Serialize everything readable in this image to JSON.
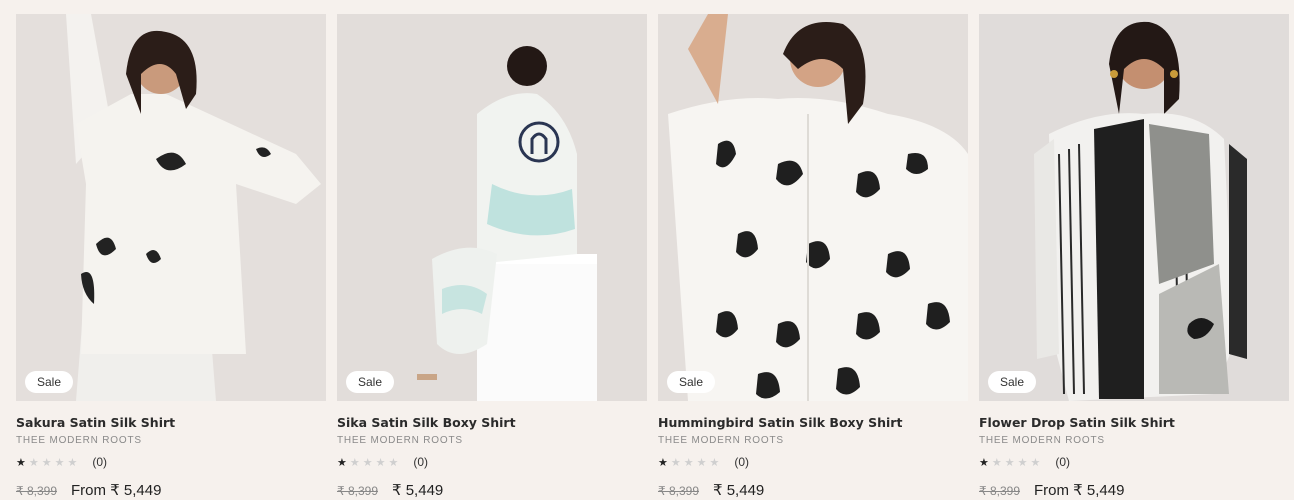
{
  "products": [
    {
      "title": "Sakura Satin Silk Shirt",
      "vendor": "THEE MODERN ROOTS",
      "badge": "Sale",
      "rating_count": "(0)",
      "compare_price": "₹ 8,399",
      "price": "From ₹ 5,449",
      "stars_filled": 1,
      "stars_total": 5
    },
    {
      "title": "Sika Satin Silk Boxy Shirt",
      "vendor": "THEE MODERN ROOTS",
      "badge": "Sale",
      "rating_count": "(0)",
      "compare_price": "₹ 8,399",
      "price": "₹ 5,449",
      "stars_filled": 1,
      "stars_total": 5
    },
    {
      "title": "Hummingbird Satin Silk Boxy Shirt",
      "vendor": "THEE MODERN ROOTS",
      "badge": "Sale",
      "rating_count": "(0)",
      "compare_price": "₹ 8,399",
      "price": "₹ 5,449",
      "stars_filled": 1,
      "stars_total": 5
    },
    {
      "title": "Flower Drop Satin Silk Shirt",
      "vendor": "THEE MODERN ROOTS",
      "badge": "Sale",
      "rating_count": "(0)",
      "compare_price": "₹ 8,399",
      "price": "From ₹ 5,449",
      "stars_filled": 1,
      "stars_total": 5
    }
  ],
  "colors": {
    "page_background": "#f6f1ed",
    "image_background": "#e7e1dd",
    "badge_background": "#ffffff"
  }
}
